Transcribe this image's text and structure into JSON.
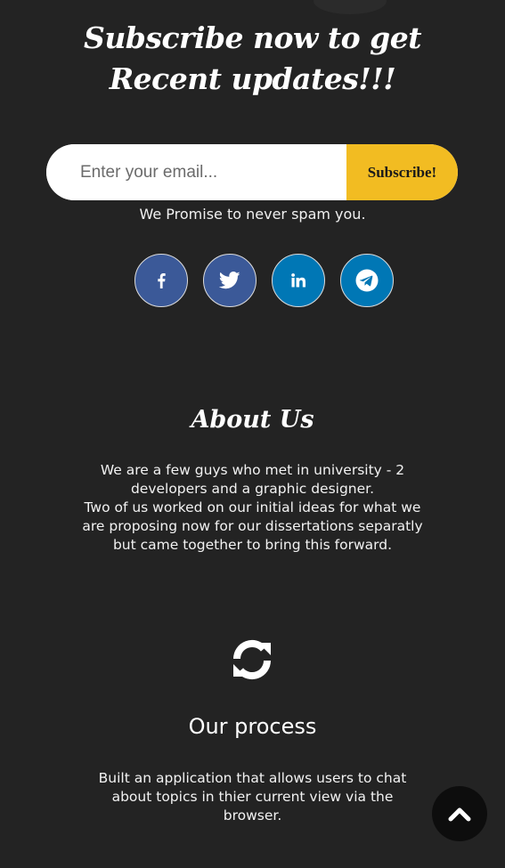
{
  "subscribe": {
    "headline": "Subscribe now to get Recent updates!!!",
    "email_placeholder": "Enter your email...",
    "button_label": "Subscribe!",
    "spam_note": "We Promise to never spam you."
  },
  "social": [
    {
      "name": "facebook",
      "icon": "facebook-icon",
      "color": "#3b5998"
    },
    {
      "name": "twitter",
      "icon": "twitter-icon",
      "color": "#3b5998"
    },
    {
      "name": "linkedin",
      "icon": "linkedin-icon",
      "color": "#0077b5"
    },
    {
      "name": "telegram",
      "icon": "telegram-icon",
      "color": "#0077b5"
    }
  ],
  "about": {
    "title": "About Us",
    "line1": "We are a few guys who met in university - 2 developers and a graphic designer.",
    "line2": "Two of us worked on our initial ideas for what we are proposing now for our dissertations separatly but came together to bring this forward."
  },
  "process": {
    "icon": "refresh-icon",
    "title": "Our process",
    "text": "Built an application that allows users to chat about topics in thier current view via the browser."
  },
  "scroll_top": {
    "icon": "chevron-up-icon"
  },
  "colors": {
    "background": "#232323",
    "accent": "#f2bc22",
    "facebook": "#3b5998",
    "linkedin": "#0077b5"
  }
}
